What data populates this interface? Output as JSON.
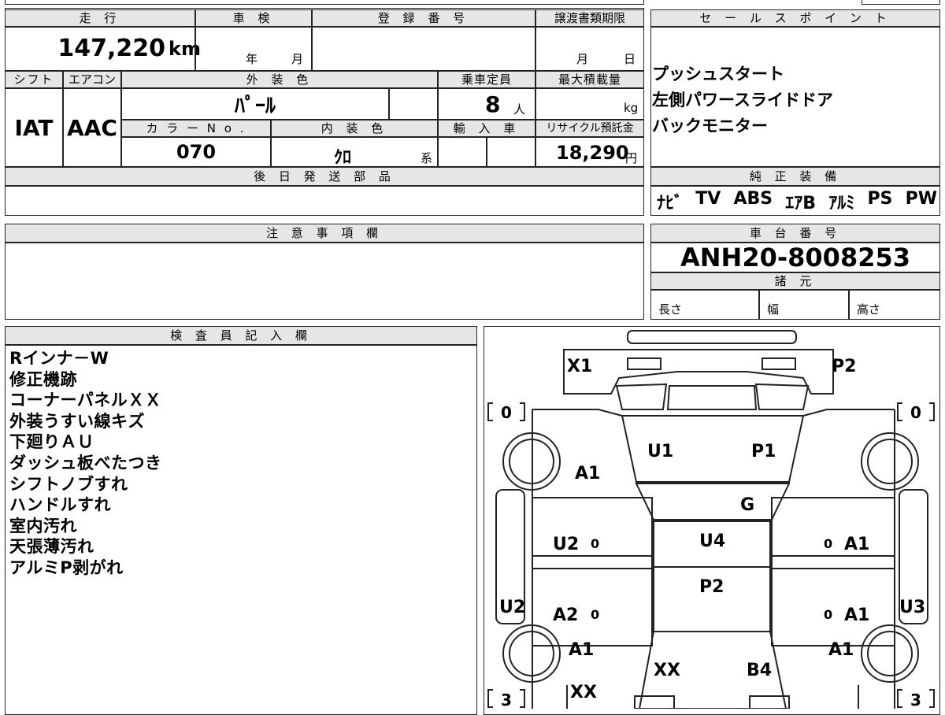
{
  "top_sheet": {
    "headers": {
      "mileage": "走 行",
      "shaken": "車 検",
      "registration": "登 録 番 号",
      "transfer_deadline": "譲渡書類期限",
      "shift": "シフト",
      "aircon": "エアコン",
      "exterior_color": "外 装 色",
      "capacity": "乗車定員",
      "max_load": "最大積載量",
      "color_no": "カ ラ ー N o .",
      "interior_color": "内 装 色",
      "import": "輸 入 車",
      "recycle_fee": "リサイクル預託金",
      "later_parts": "後 日 発 送 部 品"
    },
    "mileage_value": "147,220",
    "mileage_unit": "km",
    "shaken_year": "年",
    "shaken_month": "月",
    "transfer_month": "月",
    "transfer_day": "日",
    "shift_value": "IAT",
    "aircon_value": "AAC",
    "exterior_color_value": "ﾊﾟｰﾙ",
    "capacity_value": "8",
    "capacity_unit": "人",
    "max_load_unit": "kg",
    "color_no_value": "070",
    "interior_color_value": "ｸﾛ",
    "interior_color_suffix": "系",
    "recycle_fee_value": "18,290",
    "recycle_fee_unit": "円"
  },
  "sales_points": {
    "header": "セ ー ル ス ポ イ ン ト",
    "items": [
      "プッシュスタート",
      "左側パワースライドドア",
      "バックモニター"
    ]
  },
  "standard_equipment": {
    "header": "純 正 装 備",
    "items": [
      "ﾅﾋﾞ",
      "TV",
      "ABS",
      "ｴｱB",
      "ｱﾙﾐ",
      "PS",
      "PW"
    ]
  },
  "caution": {
    "header": "注 意 事 項 欄"
  },
  "chassis": {
    "header": "車 台 番 号",
    "number": "ANH20-8008253",
    "spec_header": "諸 元",
    "length_label": "長さ",
    "width_label": "幅",
    "height_label": "高さ"
  },
  "inspector": {
    "header": "検 査 員 記 入 欄",
    "notes": [
      "Rインナ－W",
      "修正機跡",
      "コーナーパネルＸＸ",
      "外装うすい線キズ",
      "下廻りＡＵ",
      "ダッシュ板べたつき",
      "シフトノブすれ",
      "ハンドルすれ",
      "室内汚れ",
      "天張薄汚れ",
      "アルミP剥がれ"
    ]
  },
  "diagram": {
    "labels": {
      "x1": "X1",
      "p2_top": "P2",
      "u1": "U1",
      "p1": "P1",
      "a1_fl": "A1",
      "g": "G",
      "u2_left": "U2",
      "u4": "U4",
      "a1_right_front": "A1",
      "p2_mid": "P2",
      "u2_side": "U2",
      "a2": "A2",
      "a1_right_rear": "A1",
      "u3": "U3",
      "a1_rl": "A1",
      "a1_rr": "A1",
      "xx_center": "XX",
      "b4": "B4",
      "xx_bottom": "XX"
    },
    "tire_depth": {
      "front_left": "0",
      "front_right": "0",
      "rear_left": "3",
      "rear_right": "3"
    },
    "seat_marks": {
      "fl": "0",
      "fr": "0",
      "rl": "0",
      "rr": "0"
    }
  }
}
